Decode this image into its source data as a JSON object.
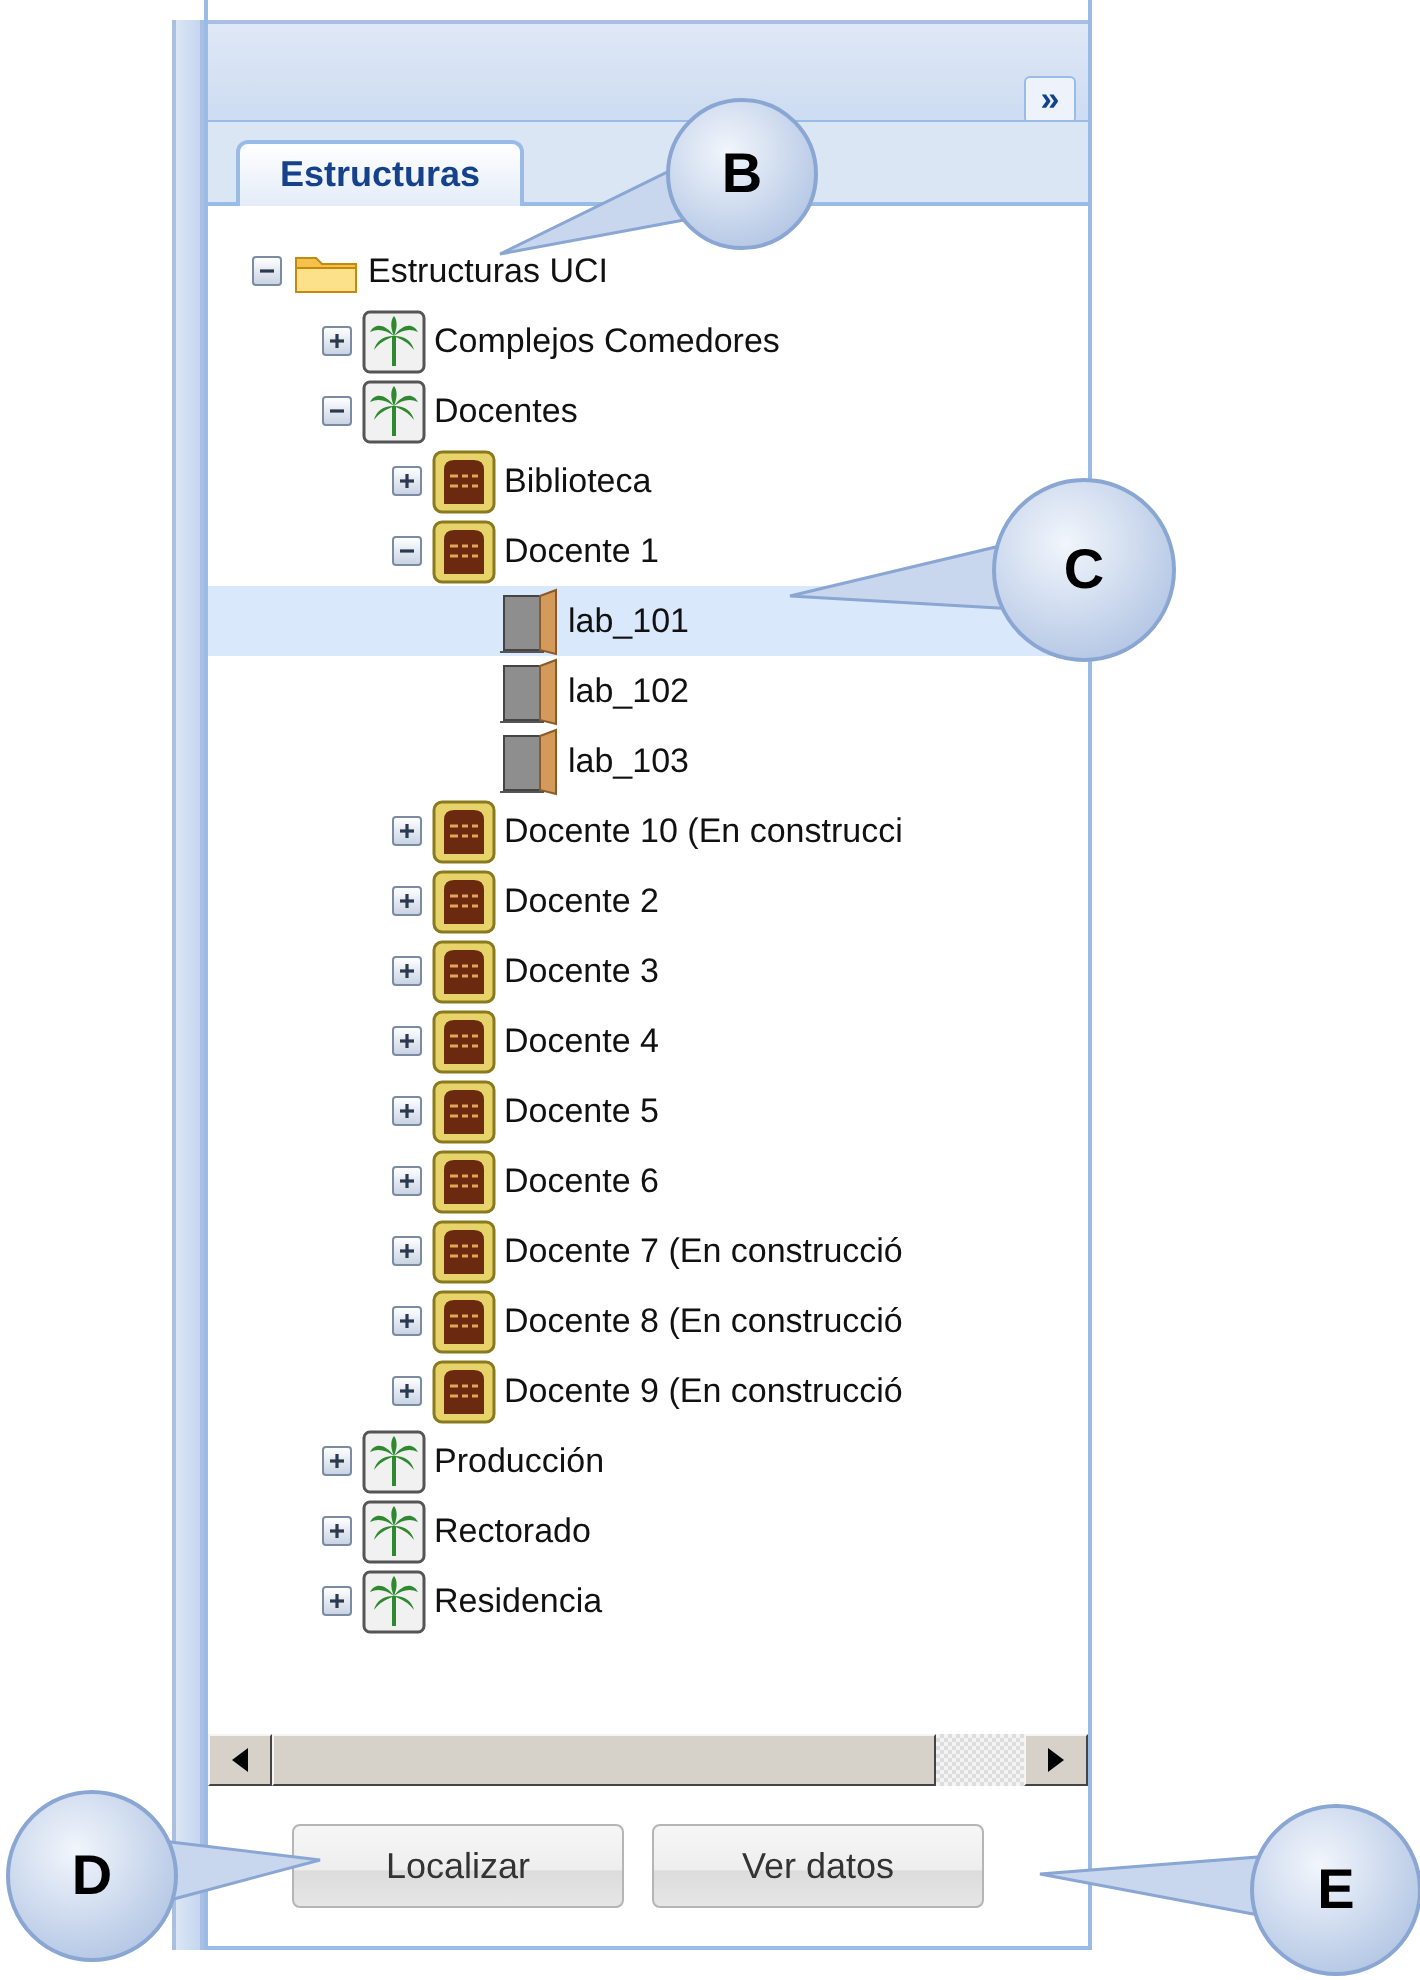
{
  "panel": {
    "collapse_button": "»",
    "tabs": [
      {
        "label": "Estructuras",
        "selected": true
      }
    ]
  },
  "tree": [
    {
      "label": "Estructuras UCI",
      "kind": "folder",
      "expanded": true,
      "selected": false,
      "children": [
        {
          "label": "Complejos Comedores",
          "kind": "area",
          "expanded": false,
          "selected": false
        },
        {
          "label": "Docentes",
          "kind": "area",
          "expanded": true,
          "selected": false,
          "children": [
            {
              "label": "Biblioteca",
              "kind": "building",
              "expanded": false,
              "selected": false
            },
            {
              "label": "Docente 1",
              "kind": "building",
              "expanded": true,
              "selected": false,
              "children": [
                {
                  "label": "lab_101",
                  "kind": "room",
                  "selected": true
                },
                {
                  "label": "lab_102",
                  "kind": "room",
                  "selected": false
                },
                {
                  "label": "lab_103",
                  "kind": "room",
                  "selected": false
                }
              ]
            },
            {
              "label": "Docente 10 (En construcci",
              "kind": "building",
              "expanded": false,
              "selected": false
            },
            {
              "label": "Docente 2",
              "kind": "building",
              "expanded": false,
              "selected": false
            },
            {
              "label": "Docente 3",
              "kind": "building",
              "expanded": false,
              "selected": false
            },
            {
              "label": "Docente 4",
              "kind": "building",
              "expanded": false,
              "selected": false
            },
            {
              "label": "Docente 5",
              "kind": "building",
              "expanded": false,
              "selected": false
            },
            {
              "label": "Docente 6",
              "kind": "building",
              "expanded": false,
              "selected": false
            },
            {
              "label": "Docente 7 (En construcció",
              "kind": "building",
              "expanded": false,
              "selected": false
            },
            {
              "label": "Docente 8 (En construcció",
              "kind": "building",
              "expanded": false,
              "selected": false
            },
            {
              "label": "Docente 9 (En construcció",
              "kind": "building",
              "expanded": false,
              "selected": false
            }
          ]
        },
        {
          "label": "Producción",
          "kind": "area",
          "expanded": false,
          "selected": false
        },
        {
          "label": "Rectorado",
          "kind": "area",
          "expanded": false,
          "selected": false
        },
        {
          "label": "Residencia",
          "kind": "area",
          "expanded": false,
          "selected": false
        }
      ]
    }
  ],
  "buttons": [
    "Localizar",
    "Ver datos"
  ],
  "callouts": [
    "B",
    "C",
    "D",
    "E"
  ]
}
